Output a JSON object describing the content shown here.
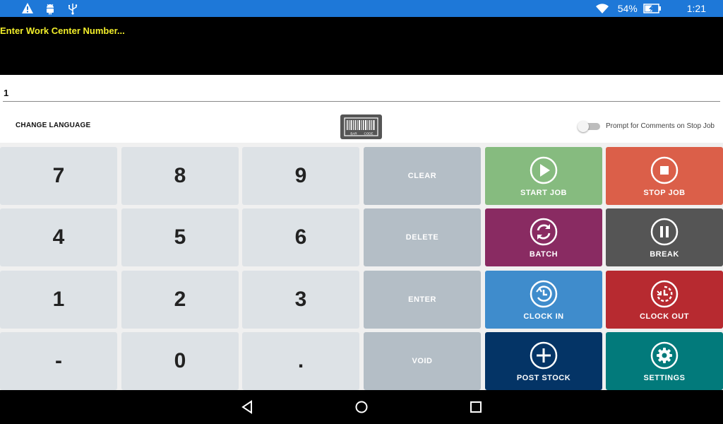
{
  "status_bar": {
    "battery": "54%",
    "time": "1:21",
    "icons": [
      "warning-icon",
      "android-icon",
      "usb-icon",
      "wifi-icon",
      "battery-charging-icon"
    ]
  },
  "header": {
    "prompt": "Enter Work Center Number..."
  },
  "input": {
    "value": "1"
  },
  "options": {
    "change_language": "CHANGE LANGUAGE",
    "barcode_lines": [
      "BAR",
      "CODE"
    ],
    "toggle_label": "Prompt for Comments on Stop Job",
    "toggle_on": false
  },
  "keypad": {
    "digits": [
      "7",
      "8",
      "9",
      "4",
      "5",
      "6",
      "1",
      "2",
      "3",
      "-",
      "0",
      "."
    ],
    "functions": [
      "CLEAR",
      "DELETE",
      "ENTER",
      "VOID"
    ]
  },
  "actions": {
    "start_job": {
      "label": "START JOB",
      "color": "#86bb7f"
    },
    "stop_job": {
      "label": "STOP JOB",
      "color": "#db5f49"
    },
    "batch": {
      "label": "BATCH",
      "color": "#892b62"
    },
    "break": {
      "label": "BREAK",
      "color": "#555555"
    },
    "clock_in": {
      "label": "CLOCK IN",
      "color": "#3f8ccc"
    },
    "clock_out": {
      "label": "CLOCK OUT",
      "color": "#b72a30"
    },
    "post_stock": {
      "label": "POST STOCK",
      "color": "#043466"
    },
    "settings": {
      "label": "SETTINGS",
      "color": "#027a7b"
    }
  }
}
